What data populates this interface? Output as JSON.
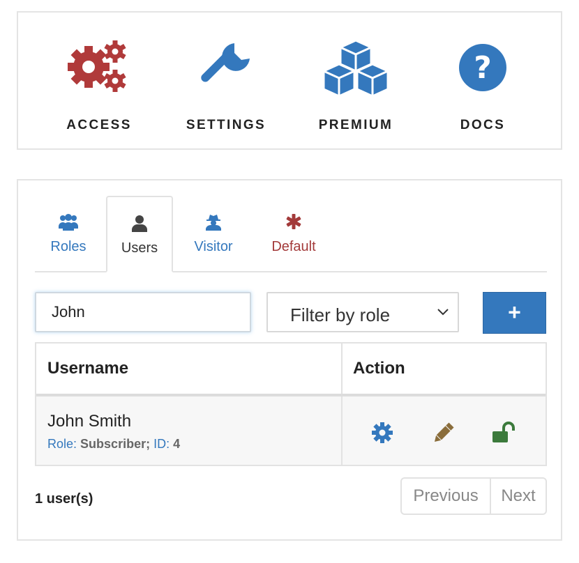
{
  "toolbar": {
    "items": [
      {
        "label": "ACCESS",
        "icon": "gears-icon"
      },
      {
        "label": "SETTINGS",
        "icon": "wrench-icon"
      },
      {
        "label": "PREMIUM",
        "icon": "cubes-icon"
      },
      {
        "label": "DOCS",
        "icon": "question-circle-icon"
      }
    ]
  },
  "tabs": [
    {
      "label": "Roles",
      "icon": "users-icon",
      "color": "#3478bd"
    },
    {
      "label": "Users",
      "icon": "user-icon",
      "color": "#333333",
      "active": true
    },
    {
      "label": "Visitor",
      "icon": "user-secret-icon",
      "color": "#3478bd"
    },
    {
      "label": "Default",
      "icon": "asterisk-icon",
      "color": "#a33a3a"
    }
  ],
  "search": {
    "value": "John"
  },
  "filter": {
    "selected": "Filter by role"
  },
  "add_button": {
    "label": "+"
  },
  "table": {
    "headers": [
      "Username",
      "Action"
    ],
    "rows": [
      {
        "name": "John Smith",
        "role_key": "Role:",
        "role_value": "Subscriber;",
        "id_key": "ID:",
        "id_value": "4"
      }
    ]
  },
  "footer": {
    "count": "1 user(s)",
    "previous": "Previous",
    "next": "Next"
  },
  "colors": {
    "accent": "#3478bd",
    "danger": "#a33a3a",
    "edit": "#8a6d3b",
    "success": "#3c7a3c"
  }
}
